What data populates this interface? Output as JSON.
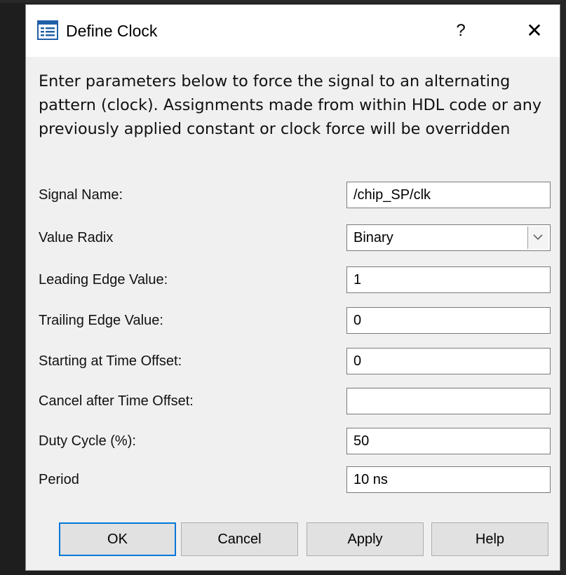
{
  "dialog": {
    "title": "Define Clock",
    "help_label": "?",
    "close_label": "✕",
    "icon": "form-icon",
    "description": "Enter parameters below to force the signal to an alternating pattern (clock). Assignments made from within HDL code or any previously applied constant or clock force will be overridden"
  },
  "form": {
    "signal_name": {
      "label": "Signal Name:",
      "value": "/chip_SP/clk"
    },
    "value_radix": {
      "label": "Value Radix",
      "value": "Binary",
      "icon": "chevron-down-icon"
    },
    "leading_edge": {
      "label": "Leading Edge Value:",
      "value": "1"
    },
    "trailing_edge": {
      "label": "Trailing Edge Value:",
      "value": "0"
    },
    "start_offset": {
      "label": "Starting at Time Offset:",
      "value": "0"
    },
    "cancel_offset": {
      "label": "Cancel after Time Offset:",
      "value": ""
    },
    "duty_cycle": {
      "label": "Duty Cycle (%):",
      "value": "50"
    },
    "period": {
      "label": "Period",
      "value": "10 ns"
    }
  },
  "buttons": {
    "ok": "OK",
    "cancel": "Cancel",
    "apply": "Apply",
    "help": "Help"
  },
  "colors": {
    "dialog_bg": "#f0f0f0",
    "titlebar_bg": "#ffffff",
    "default_button_border": "#0078d7",
    "backdrop": "#1e1e1e"
  }
}
